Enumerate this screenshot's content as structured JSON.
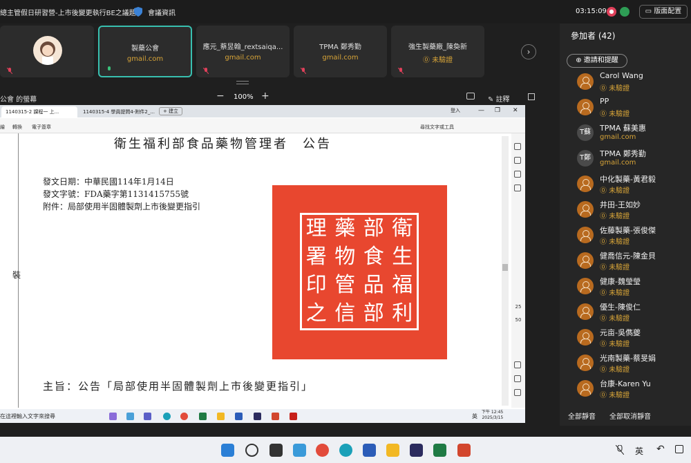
{
  "meeting": {
    "title": "總主管假日研習營-上市後變更執行BE之議題",
    "info_label": "會議資訊",
    "clock": "03:15:09",
    "layout_label": "版面配置"
  },
  "tiles": [
    {
      "name": "",
      "sub": ""
    },
    {
      "name": "製藥公會",
      "sub": "gmail.com"
    },
    {
      "name": "應元_蔡昱翰_rextsaiqa...",
      "sub": "gmail.com"
    },
    {
      "name": "TPMA 鄭秀勤",
      "sub": "gmail.com"
    },
    {
      "name": "強生製藥廠_陳奐新",
      "sub": "⓪ 未驗證"
    }
  ],
  "share": {
    "label": "公會 的螢幕",
    "zoom": "100%",
    "annotate": "註釋"
  },
  "browser": {
    "tab1": "1140315-2 課程一 上...",
    "tab2": "1140315-4 學員提問4-附件2_...",
    "newtab": "+ 建立",
    "login": "登入"
  },
  "pdf": {
    "tools": [
      "繪",
      "轉換",
      "電子簽章"
    ],
    "find": "尋找文字或工具",
    "page_num": "25",
    "page_total": "50"
  },
  "doc": {
    "heading": "衛生福利部食品藥物管理者　公告",
    "date": "發文日期：中華民國114年1月14日",
    "number": "發文字號：FDA藥字第1131415755號",
    "attachment": "附件：局部使用半固體製劑上市後變更指引",
    "seal_chars": [
      "衛",
      "生",
      "福",
      "利",
      "部",
      "食",
      "品",
      "藥",
      "物",
      "管",
      "理",
      "署",
      "印",
      "之",
      "信",
      "部"
    ],
    "subject": "主旨：公告「局部使用半固體製劑上市後變更指引」",
    "margin": "裝"
  },
  "screen_taskbar": {
    "search": "在這裡輸入文字來搜尋",
    "ime": "英",
    "time": "下午 12:45",
    "date": "2025/3/15"
  },
  "panel": {
    "title": "參加者 (42)",
    "invite": "邀請和提醒",
    "participants": [
      {
        "name": "Carol Wang",
        "status": "⓪ 未驗證",
        "type": "user"
      },
      {
        "name": "PP",
        "status": "⓪ 未驗證",
        "type": "user"
      },
      {
        "name": "TPMA 蘇美惠",
        "status": "gmail.com",
        "type": "text",
        "initial": "T蘇"
      },
      {
        "name": "TPMA 鄭秀勤",
        "status": "gmail.com",
        "type": "text",
        "initial": "T鄭"
      },
      {
        "name": "中化製藥-黃君毅",
        "status": "⓪ 未驗證",
        "type": "user"
      },
      {
        "name": "井田-王如妙",
        "status": "⓪ 未驗證",
        "type": "user"
      },
      {
        "name": "佐藤製藥-張俊傑",
        "status": "⓪ 未驗證",
        "type": "user"
      },
      {
        "name": "健喬信元-陳金貝",
        "status": "⓪ 未驗證",
        "type": "user"
      },
      {
        "name": "健康-魏瑩瑩",
        "status": "⓪ 未驗證",
        "type": "user"
      },
      {
        "name": "優生-陳俊仁",
        "status": "⓪ 未驗證",
        "type": "user"
      },
      {
        "name": "元亩-吳儁夔",
        "status": "⓪ 未驗證",
        "type": "user"
      },
      {
        "name": "光南製藥-蔡旻娟",
        "status": "⓪ 未驗證",
        "type": "user"
      },
      {
        "name": "台康-Karen Yu",
        "status": "⓪ 未驗證",
        "type": "user"
      }
    ],
    "mute_all": "全部靜音",
    "unmute_all": "全部取消靜音"
  },
  "taskbar": {
    "ime": "英"
  }
}
